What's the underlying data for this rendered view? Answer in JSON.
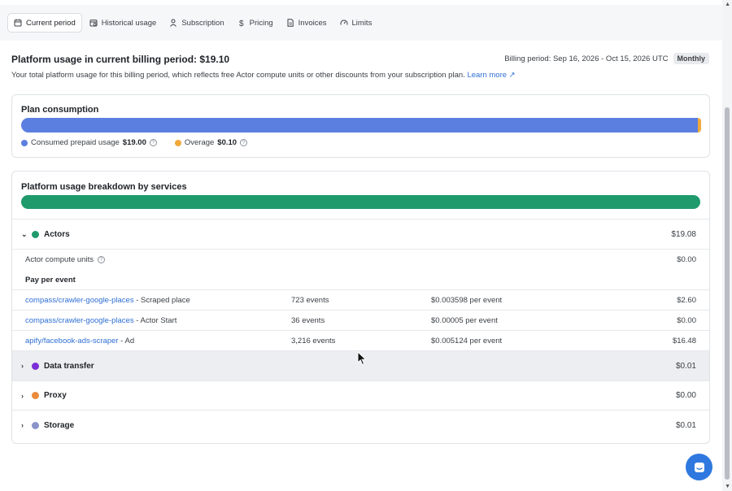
{
  "tabs": [
    {
      "label": "Current period",
      "icon": "calendar-icon"
    },
    {
      "label": "Historical usage",
      "icon": "calendar-history-icon"
    },
    {
      "label": "Subscription",
      "icon": "user-icon"
    },
    {
      "label": "Pricing",
      "icon": "dollar-icon"
    },
    {
      "label": "Invoices",
      "icon": "document-icon"
    },
    {
      "label": "Limits",
      "icon": "gauge-icon"
    }
  ],
  "header": {
    "title": "Platform usage in current billing period: $19.10",
    "billing_period": "Billing period: Sep 16, 2026 - Oct 15, 2026 UTC",
    "badge": "Monthly",
    "description": "Your total platform usage for this billing period, which reflects free Actor compute units or other discounts from your subscription plan.",
    "learn_more": "Learn more ↗"
  },
  "plan": {
    "title": "Plan consumption",
    "prepaid_label": "Consumed prepaid usage",
    "prepaid_value": "$19.00",
    "overage_label": "Overage",
    "overage_value": "$0.10",
    "prepaid_fraction": 0.995,
    "colors": {
      "prepaid": "#5b7fe0",
      "overage": "#f2a93b"
    }
  },
  "breakdown": {
    "title": "Platform usage breakdown by services",
    "actors": {
      "label": "Actors",
      "amount": "$19.08",
      "color": "#1f9a6c"
    },
    "compute": {
      "label": "Actor compute units",
      "amount": "$0.00"
    },
    "ppe_label": "Pay per event",
    "events": [
      {
        "actor": "compass/crawler-google-places",
        "event": " - Scraped place",
        "count": "723 events",
        "price": "$0.003598 per event",
        "amount": "$2.60"
      },
      {
        "actor": "compass/crawler-google-places",
        "event": " - Actor Start",
        "count": "36 events",
        "price": "$0.00005 per event",
        "amount": "$0.00"
      },
      {
        "actor": "apify/facebook-ads-scraper",
        "event": " - Ad",
        "count": "3,216 events",
        "price": "$0.005124 per event",
        "amount": "$16.48"
      }
    ],
    "data_transfer": {
      "label": "Data transfer",
      "amount": "$0.01",
      "color": "#7b2fd6"
    },
    "proxy": {
      "label": "Proxy",
      "amount": "$0.00",
      "color": "#e98b3a"
    },
    "storage": {
      "label": "Storage",
      "amount": "$0.01",
      "color": "#8b94c9"
    }
  }
}
